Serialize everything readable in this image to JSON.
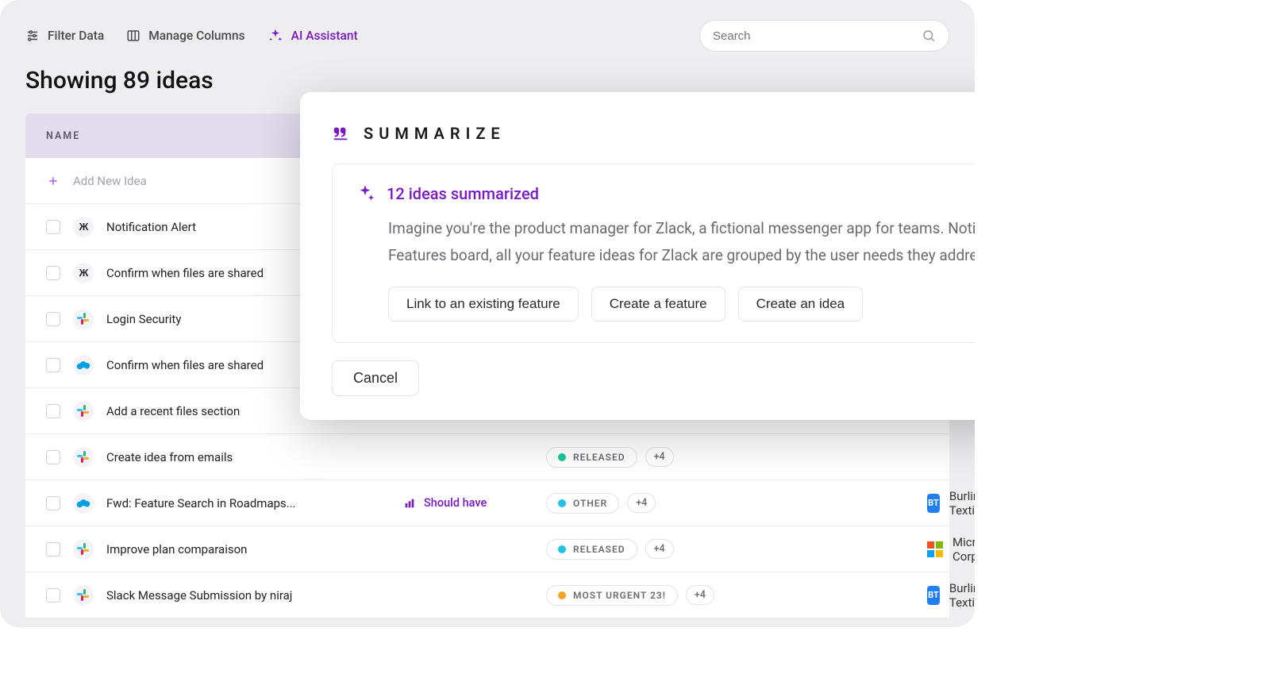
{
  "toolbar": {
    "filter_label": "Filter Data",
    "columns_label": "Manage Columns",
    "ai_label": "AI Assistant",
    "search_placeholder": "Search"
  },
  "heading": "Showing 89 ideas",
  "table": {
    "header_name": "NAME",
    "add_new_label": "Add New Idea",
    "rows": [
      {
        "source": "zendesk",
        "name": "Notification Alert",
        "priority": "",
        "status": "",
        "status_color": "",
        "extra": "",
        "src_company": "",
        "src_badge": "",
        "src_badge_color": ""
      },
      {
        "source": "zendesk",
        "name": "Confirm when files are shared",
        "priority": "",
        "status": "",
        "status_color": "",
        "extra": "",
        "src_company": "",
        "src_badge": "",
        "src_badge_color": ""
      },
      {
        "source": "slack",
        "name": "Login Security",
        "priority": "",
        "status": "",
        "status_color": "",
        "extra": "",
        "src_company": "",
        "src_badge": "",
        "src_badge_color": ""
      },
      {
        "source": "salesforce",
        "name": "Confirm when files are shared",
        "priority": "",
        "status": "",
        "status_color": "",
        "extra": "",
        "src_company": "",
        "src_badge": "",
        "src_badge_color": ""
      },
      {
        "source": "slack",
        "name": "Add a recent files section",
        "priority": "",
        "status": "",
        "status_color": "",
        "extra": "",
        "src_company": "",
        "src_badge": "",
        "src_badge_color": ""
      },
      {
        "source": "slack",
        "name": "Create idea from emails",
        "priority": "",
        "status": "RELEASED",
        "status_color": "#12c99b",
        "extra": "+4",
        "src_company": "",
        "src_badge": "",
        "src_badge_color": ""
      },
      {
        "source": "salesforce",
        "name": "Fwd: Feature Search in Roadmaps...",
        "priority": "Should have",
        "status": "OTHER",
        "status_color": "#21c3e6",
        "extra": "+4",
        "src_company": "Burlington Textile",
        "src_badge": "BT",
        "src_badge_color": "#1f7ef0"
      },
      {
        "source": "slack",
        "name": "Improve plan comparaison",
        "priority": "",
        "status": "RELEASED",
        "status_color": "#21c3e6",
        "extra": "+4",
        "src_company": "Microsoft Corp.",
        "src_badge": "ms",
        "src_badge_color": ""
      },
      {
        "source": "slack",
        "name": "Slack Message Submission by niraj",
        "priority": "",
        "status": "MOST URGENT 23!",
        "status_color": "#f5a523",
        "extra": "+4",
        "src_company": "Burlington Textile",
        "src_badge": "BT",
        "src_badge_color": "#1f7ef0"
      }
    ]
  },
  "modal": {
    "title": "SUMMARIZE",
    "card_title": "12 ideas summarized",
    "card_text": "Imagine you're the product manager for Zlack, a fictional messenger app for teams. Notice how on the Features board, all your feature ideas for Zlack are grouped by the user needs they address.",
    "action_link": "Link to an existing feature",
    "action_feature": "Create a feature",
    "action_idea": "Create an idea",
    "cancel": "Cancel"
  }
}
